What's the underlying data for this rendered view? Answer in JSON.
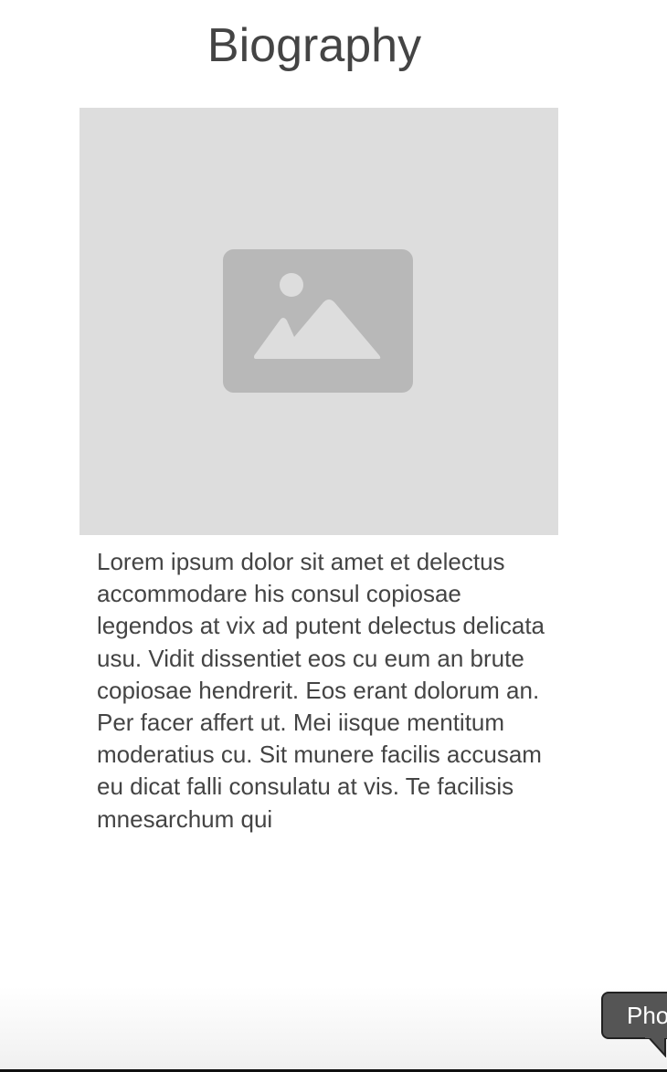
{
  "page": {
    "title": "Biography"
  },
  "photo": {
    "icon": "image-icon",
    "background_color": "#dddddd",
    "icon_color": "#b8b8b8"
  },
  "bio": {
    "text": "Lorem ipsum dolor sit amet et delectus accommodare his consul copiosae legendos at vix ad putent delectus delicata usu. Vidit dissentiet eos cu eum an brute copiosae hendrerit. Eos erant dolorum an. Per facer affert ut. Mei iisque mentitum moderatius cu. Sit munere facilis accusam eu dicat falli consulatu at vis. Te facilisis mnesarchum qui"
  },
  "tooltip": {
    "label": "Pho",
    "background_color": "#555555"
  }
}
